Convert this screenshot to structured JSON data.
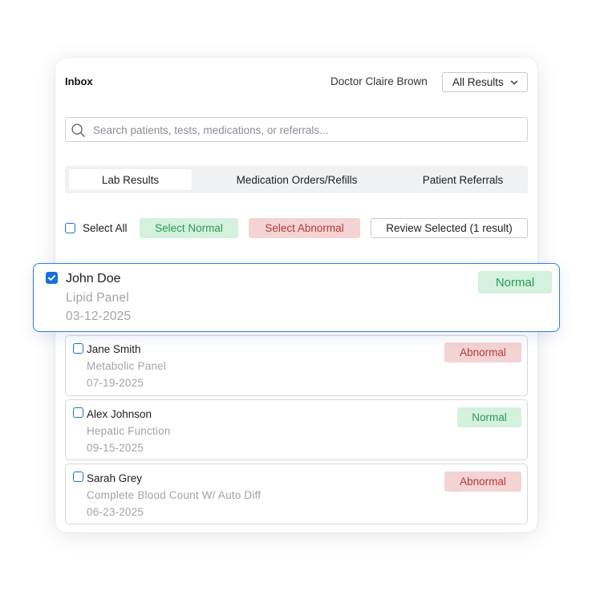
{
  "header": {
    "title": "Inbox",
    "doctor": "Doctor Claire Brown",
    "filter": {
      "selected": "All Results",
      "icon": "chevron-down-icon"
    }
  },
  "search": {
    "placeholder": "Search patients, tests, medications, or referrals...",
    "value": "",
    "icon": "search-icon"
  },
  "tabs": [
    {
      "label": "Lab Results",
      "active": true
    },
    {
      "label": "Medication Orders/Refills",
      "active": false
    },
    {
      "label": "Patient Referrals",
      "active": false
    }
  ],
  "toolbar": {
    "select_all": "Select All",
    "select_normal": "Select Normal",
    "select_abnormal": "Select Abnormal",
    "review_selected": "Review Selected (1 result)"
  },
  "results": [
    {
      "name": "John Doe",
      "test": "Lipid Panel",
      "date": "03-12-2025",
      "status": "Normal",
      "checked": true
    },
    {
      "name": "Jane Smith",
      "test": "Metabolic Panel",
      "date": "07-19-2025",
      "status": "Abnormal",
      "checked": false
    },
    {
      "name": "Alex Johnson",
      "test": "Hepatic Function",
      "date": "09-15-2025",
      "status": "Normal",
      "checked": false
    },
    {
      "name": "Sarah Grey",
      "test": "Complete Blood Count W/ Auto Diff",
      "date": "06-23-2025",
      "status": "Abnormal",
      "checked": false
    }
  ],
  "colors": {
    "accent": "#1a6fd6",
    "normal_bg": "#d3f1dd",
    "normal_text": "#2a9a55",
    "abnormal_bg": "#f3d3d3",
    "abnormal_text": "#b33a3a"
  }
}
